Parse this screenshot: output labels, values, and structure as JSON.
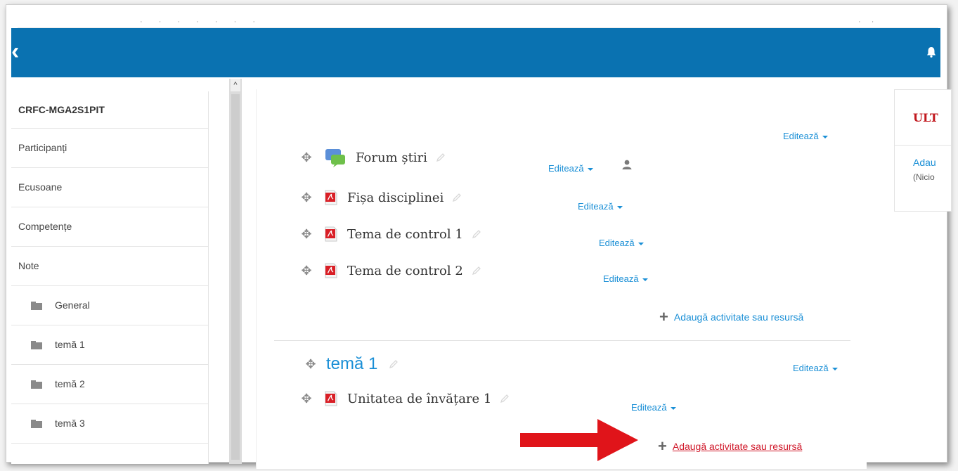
{
  "navbar": {
    "color": "#0a72b1"
  },
  "sidebar": {
    "course_title": "CRFC-MGA2S1PIT",
    "items": [
      "Participanți",
      "Ecusoane",
      "Competențe",
      "Note"
    ],
    "sections": [
      "General",
      "temă 1",
      "temă 2",
      "temă 3"
    ]
  },
  "main": {
    "section_edit_top": "Editează",
    "activities": [
      {
        "name": "Forum știri",
        "icon": "forum-icon",
        "edit": "Editează"
      },
      {
        "name": "Fișa disciplinei",
        "icon": "pdf-icon",
        "edit": "Editează"
      },
      {
        "name": "Tema de control 1",
        "icon": "pdf-icon",
        "edit": "Editează"
      },
      {
        "name": "Tema de control 2",
        "icon": "pdf-icon",
        "edit": "Editează"
      }
    ],
    "add_resource_1": "Adaugă activitate sau resursă",
    "section2": {
      "title": "temă 1",
      "edit": "Editează",
      "activity": {
        "name": "Unitatea de învățare 1",
        "icon": "pdf-icon",
        "edit": "Editează"
      },
      "add_resource": "Adaugă activitate sau resursă"
    }
  },
  "right_block": {
    "heading": "ULT",
    "link": "Adau",
    "note": "(Nicio"
  },
  "colors": {
    "link": "#1a8fd6",
    "annotation_arrow": "#e0141a",
    "heading_red": "#c1181e"
  }
}
